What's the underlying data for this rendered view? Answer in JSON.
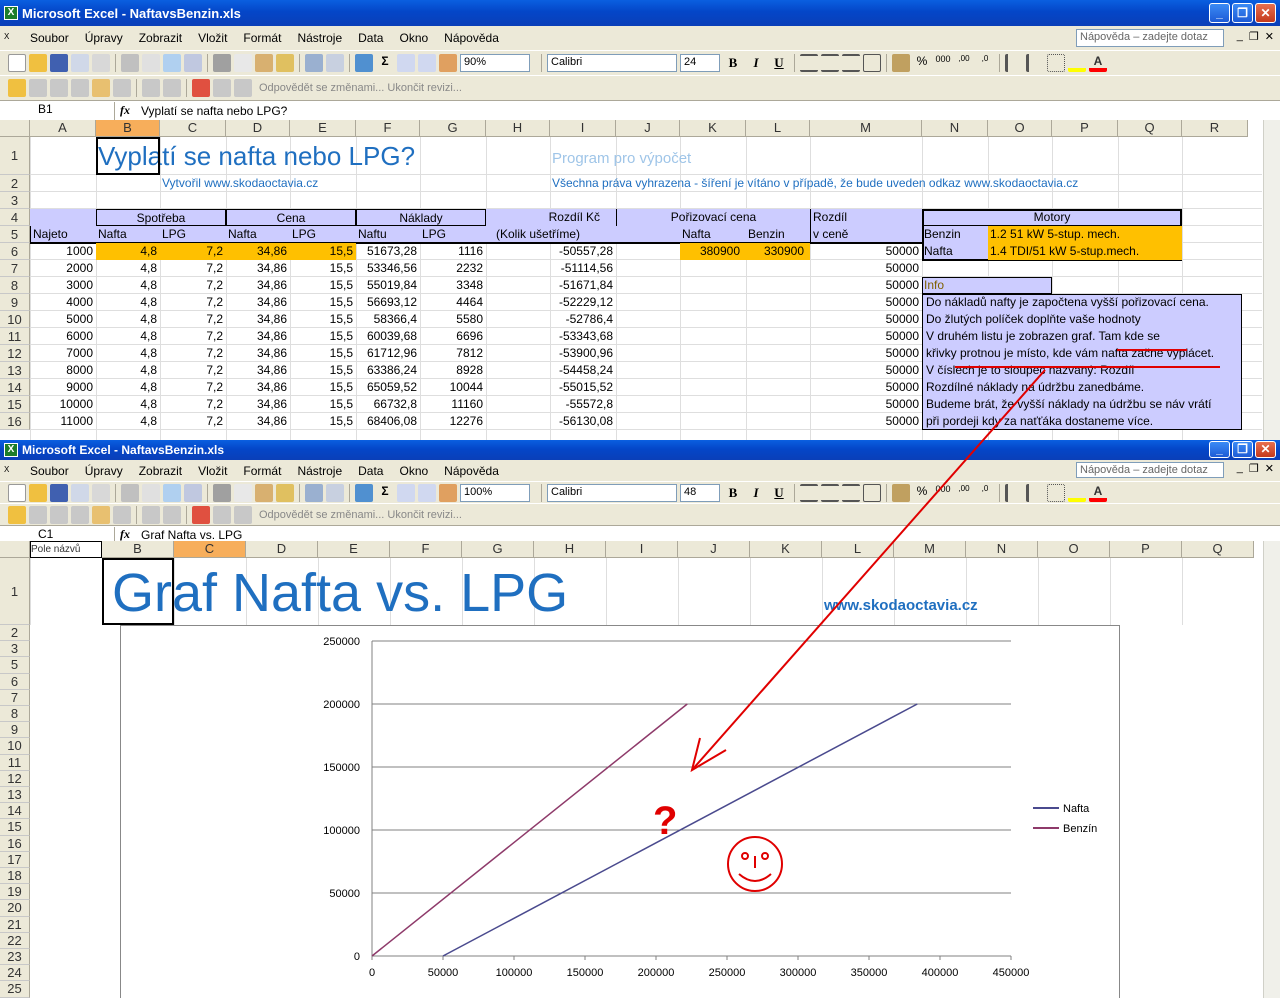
{
  "w1": {
    "title": "Microsoft Excel - NaftavsBenzin.xls",
    "menu": [
      "Soubor",
      "Úpravy",
      "Zobrazit",
      "Vložit",
      "Formát",
      "Nástroje",
      "Data",
      "Okno",
      "Nápověda"
    ],
    "help_placeholder": "Nápověda – zadejte dotaz",
    "zoom": "90%",
    "font": "Calibri",
    "font_size": "24",
    "review_toolbar": "Odpovědět se změnami...  Ukončit revizi...",
    "name_box": "B1",
    "formula": "Vyplatí se nafta nebo LPG?",
    "columns": [
      "A",
      "B",
      "C",
      "D",
      "E",
      "F",
      "G",
      "H",
      "I",
      "J",
      "K",
      "L",
      "M",
      "N",
      "O",
      "P",
      "Q",
      "R"
    ],
    "rows": [
      "1",
      "2",
      "3",
      "4",
      "5",
      "6",
      "7",
      "8",
      "9",
      "10",
      "11",
      "12",
      "13",
      "14",
      "15",
      "16"
    ],
    "title_text": "Vyplatí se nafta nebo LPG?",
    "program_text": "Program pro výpočet",
    "author_text": "Vytvořil www.skodaoctavia.cz",
    "rights_text": "Všechna práva vyhrazena - šíření je vítáno v případě, že bude uveden odkaz www.skodaoctavia.cz",
    "headers": {
      "spotreba": "Spotřeba",
      "cena": "Cena",
      "naklady": "Náklady",
      "rozdil_kc": "Rozdíl Kč",
      "porizovaci": "Pořizovací cena",
      "rozdil": "Rozdíl",
      "motory": "Motory",
      "najeto": "Najeto",
      "nafta": "Nafta",
      "lpg": "LPG",
      "naftu": "Naftu",
      "kolik": "(Kolik ušetříme)",
      "benzin": "Benzin",
      "v_cene": "v ceně"
    },
    "data_rows": [
      [
        "1000",
        "4,8",
        "7,2",
        "34,86",
        "15,5",
        "51673,28",
        "1116",
        "-50557,28",
        "50000"
      ],
      [
        "2000",
        "4,8",
        "7,2",
        "34,86",
        "15,5",
        "53346,56",
        "2232",
        "-51114,56",
        "50000"
      ],
      [
        "3000",
        "4,8",
        "7,2",
        "34,86",
        "15,5",
        "55019,84",
        "3348",
        "-51671,84",
        "50000"
      ],
      [
        "4000",
        "4,8",
        "7,2",
        "34,86",
        "15,5",
        "56693,12",
        "4464",
        "-52229,12",
        "50000"
      ],
      [
        "5000",
        "4,8",
        "7,2",
        "34,86",
        "15,5",
        "58366,4",
        "5580",
        "-52786,4",
        "50000"
      ],
      [
        "6000",
        "4,8",
        "7,2",
        "34,86",
        "15,5",
        "60039,68",
        "6696",
        "-53343,68",
        "50000"
      ],
      [
        "7000",
        "4,8",
        "7,2",
        "34,86",
        "15,5",
        "61712,96",
        "7812",
        "-53900,96",
        "50000"
      ],
      [
        "8000",
        "4,8",
        "7,2",
        "34,86",
        "15,5",
        "63386,24",
        "8928",
        "-54458,24",
        "50000"
      ],
      [
        "9000",
        "4,8",
        "7,2",
        "34,86",
        "15,5",
        "65059,52",
        "10044",
        "-55015,52",
        "50000"
      ],
      [
        "10000",
        "4,8",
        "7,2",
        "34,86",
        "15,5",
        "66732,8",
        "11160",
        "-55572,8",
        "50000"
      ],
      [
        "11000",
        "4,8",
        "7,2",
        "34,86",
        "15,5",
        "68406,08",
        "12276",
        "-56130,08",
        "50000"
      ]
    ],
    "price_nafta": "380900",
    "price_benzin": "330900",
    "motor_benzin_label": "Benzin",
    "motor_benzin": "1.2 51 kW 5-stup. mech.",
    "motor_nafta_label": "Nafta",
    "motor_nafta": "1.4 TDI/51 kW 5-stup.mech.",
    "info_label": "Info",
    "info_lines": [
      "Do nákladů nafty je započtena vyšší pořizovací cena.",
      "Do žlutých políček doplňte vaše hodnoty",
      "V druhém listu je zobrazen graf. Tam kde se",
      "křivky protnou je místo, kde  vám nafta začne vyplácet.",
      "V číslech je to sloupec nazvaný: Rozdíl",
      "Rozdílné náklady na údržbu zanedbáme.",
      "Budeme brát, že vyšší náklady na údržbu se náv vrátí",
      "při pordeji kdy za naťťáka dostaneme více."
    ]
  },
  "w2": {
    "title": "Microsoft Excel - NaftavsBenzin.xls",
    "menu": [
      "Soubor",
      "Úpravy",
      "Zobrazit",
      "Vložit",
      "Formát",
      "Nástroje",
      "Data",
      "Okno",
      "Nápověda"
    ],
    "help_placeholder": "Nápověda – zadejte dotaz",
    "zoom": "100%",
    "font": "Calibri",
    "font_size": "48",
    "review_toolbar": "Odpovědět se změnami...  Ukončit revizi...",
    "name_box": "C1",
    "tooltip": "Pole názvů",
    "formula": "Graf Nafta vs. LPG",
    "columns": [
      "A",
      "B",
      "C",
      "D",
      "E",
      "F",
      "G",
      "H",
      "I",
      "J",
      "K",
      "L",
      "M",
      "N",
      "O",
      "P",
      "Q"
    ],
    "rows": [
      "1",
      "2",
      "3",
      "5",
      "6",
      "7",
      "8",
      "9",
      "10",
      "11",
      "12",
      "13",
      "14",
      "15",
      "16",
      "17",
      "18",
      "19",
      "20",
      "21",
      "22",
      "23",
      "24",
      "25"
    ],
    "graph_title": "Graf Nafta vs. LPG",
    "site": "www.skodaoctavia.cz",
    "question_mark": "?"
  },
  "chart_data": {
    "type": "line",
    "xlim": [
      0,
      450000
    ],
    "ylim": [
      0,
      250000
    ],
    "x_ticks": [
      "0",
      "50000",
      "100000",
      "150000",
      "200000",
      "250000",
      "300000",
      "350000",
      "400000",
      "450000"
    ],
    "y_ticks": [
      "0",
      "50000",
      "100000",
      "150000",
      "200000",
      "250000"
    ],
    "legend_position": "right",
    "series": [
      {
        "name": "Nafta",
        "color": "#4a4a8e",
        "points": [
          [
            50000,
            0
          ],
          [
            384000,
            200000
          ]
        ]
      },
      {
        "name": "Benzín",
        "color": "#8e3a6a",
        "points": [
          [
            0,
            0
          ],
          [
            222000,
            200000
          ]
        ]
      }
    ]
  },
  "colors": {
    "header_fill": "#ccccff",
    "input_fill": "#ffc000",
    "title_blue": "#1f6fc0",
    "annotation_red": "#e00000"
  }
}
